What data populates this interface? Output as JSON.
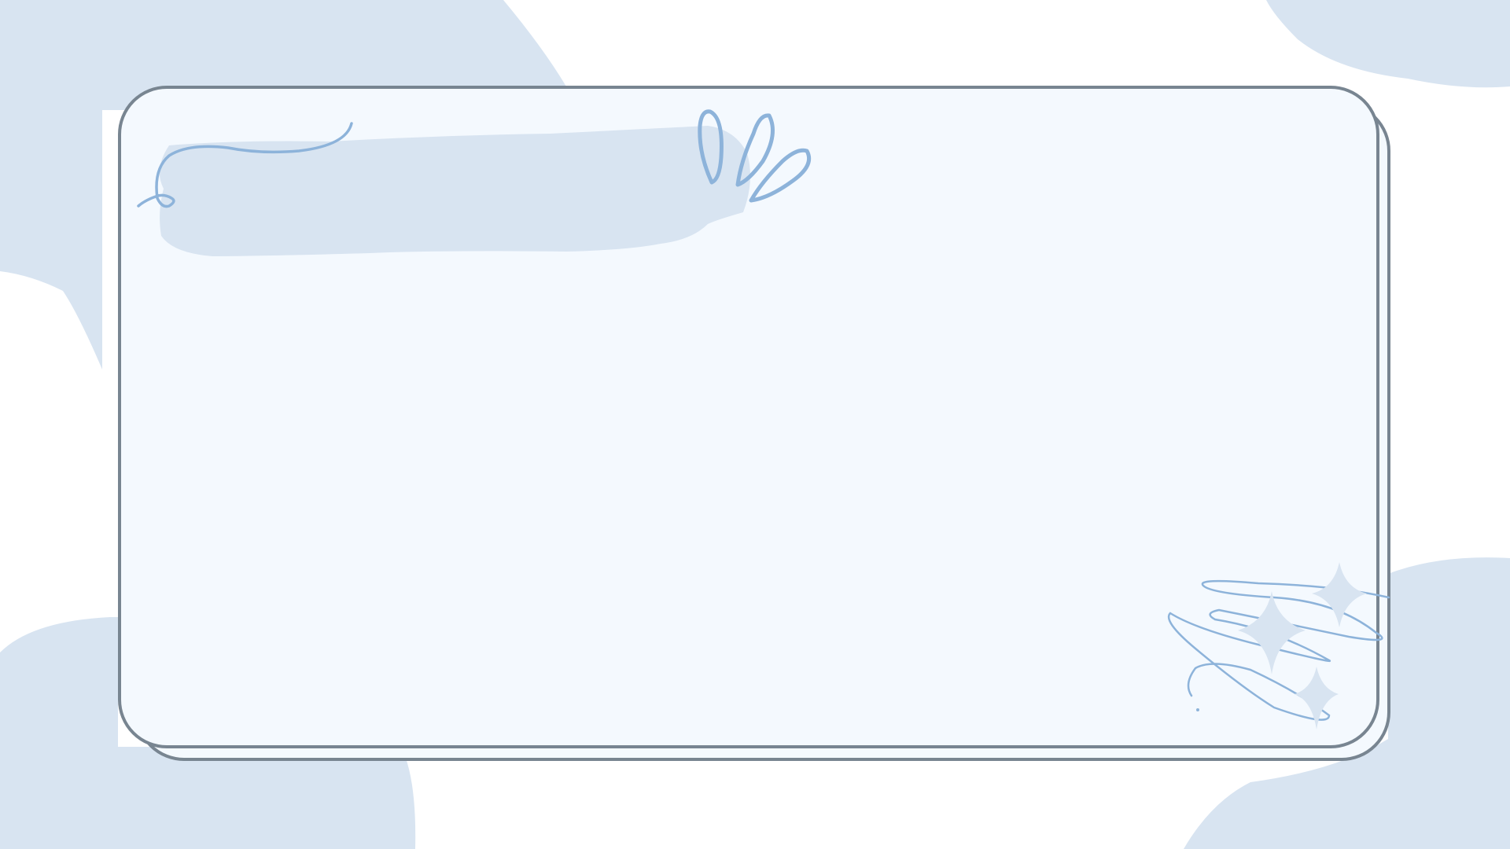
{
  "colors": {
    "background": "#ffffff",
    "blob": "#d8e4f1",
    "card_fill": "#f4f9fe",
    "card_border": "#788591",
    "doodle_stroke": "#8db3da",
    "sparkle": "#d8e4f1"
  },
  "icons": {
    "title_scribble": "swirl-doodle-icon",
    "petals": "leaf-doodle-icon",
    "sparkles": "sparkle-icon",
    "corner_scribble": "scribble-doodle-icon"
  }
}
